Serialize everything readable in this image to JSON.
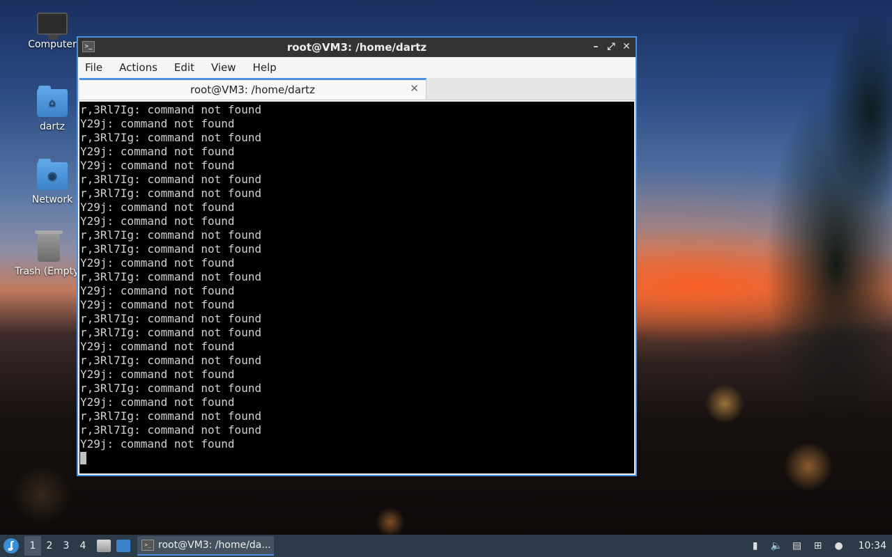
{
  "desktop": {
    "icons": [
      {
        "label": "Computer"
      },
      {
        "label": "dartz"
      },
      {
        "label": "Network"
      },
      {
        "label": "Trash (Empty)"
      }
    ]
  },
  "window": {
    "title": "root@VM3: /home/dartz",
    "menu": [
      "File",
      "Actions",
      "Edit",
      "View",
      "Help"
    ],
    "tab_label": "root@VM3: /home/dartz",
    "terminal_lines": [
      "r,3Rl7Ig: command not found",
      "Y29j: command not found",
      "r,3Rl7Ig: command not found",
      "Y29j: command not found",
      "Y29j: command not found",
      "r,3Rl7Ig: command not found",
      "r,3Rl7Ig: command not found",
      "Y29j: command not found",
      "Y29j: command not found",
      "r,3Rl7Ig: command not found",
      "r,3Rl7Ig: command not found",
      "Y29j: command not found",
      "r,3Rl7Ig: command not found",
      "Y29j: command not found",
      "Y29j: command not found",
      "r,3Rl7Ig: command not found",
      "r,3Rl7Ig: command not found",
      "Y29j: command not found",
      "r,3Rl7Ig: command not found",
      "Y29j: command not found",
      "r,3Rl7Ig: command not found",
      "Y29j: command not found",
      "r,3Rl7Ig: command not found",
      "r,3Rl7Ig: command not found",
      "Y29j: command not found"
    ]
  },
  "taskbar": {
    "workspaces": [
      "1",
      "2",
      "3",
      "4"
    ],
    "task_label": "root@VM3: /home/da...",
    "clock": "10:34"
  },
  "colors": {
    "accent": "#4a8fe0",
    "terminal_bg": "#000000",
    "terminal_fg": "#d0d0d0",
    "taskbar_bg": "#2d3a47"
  },
  "icons": {
    "window": "terminal-icon",
    "tray": [
      "battery-icon",
      "volume-icon",
      "clipboard-icon",
      "network-icon",
      "notification-icon"
    ]
  }
}
